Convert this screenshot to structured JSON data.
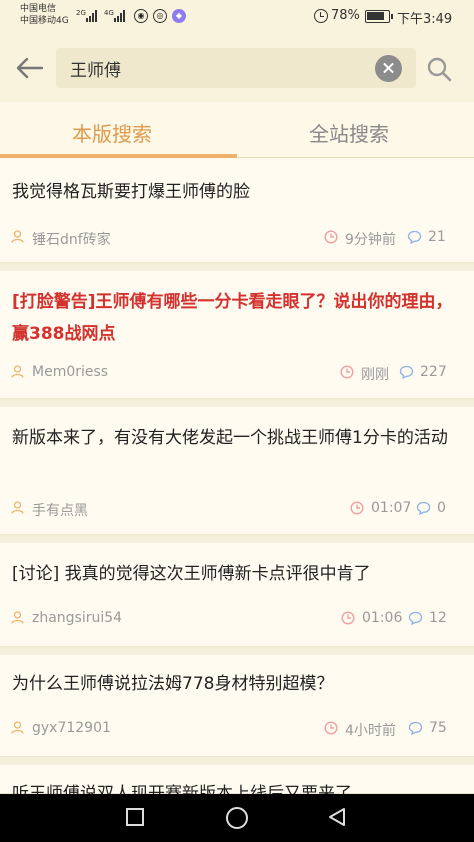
{
  "status_bar": {
    "carrier_1": "中国电信",
    "carrier_2": "中国移动4G",
    "sig_1": "2G",
    "sig_2": "4G",
    "battery": "78%",
    "time": "下午3:49"
  },
  "search": {
    "query": "王师傅"
  },
  "tabs": [
    {
      "label": "本版搜索",
      "active": true
    },
    {
      "label": "全站搜索",
      "active": false
    }
  ],
  "posts": [
    {
      "title": "我觉得格瓦斯要打爆王师傅的脸",
      "author": "锤石dnf砖家",
      "time": "9分钟前",
      "comments": "21",
      "highlight": false
    },
    {
      "title": "[打脸警告]王师傅有哪些一分卡看走眼了？说出你的理由，赢388战网点",
      "author": "Mem0riess",
      "time": "刚刚",
      "comments": "227",
      "highlight": true
    },
    {
      "title": "新版本来了，有没有大佬发起一个挑战王师傅1分卡的活动",
      "author": "手有点黑",
      "time": "01:07",
      "comments": "0",
      "highlight": false
    },
    {
      "title": "[讨论] 我真的觉得这次王师傅新卡点评很中肯了",
      "author": "zhangsirui54",
      "time": "01:06",
      "comments": "12",
      "highlight": false
    },
    {
      "title": "为什么王师傅说拉法姆778身材特别超模？",
      "author": "gyx712901",
      "time": "4小时前",
      "comments": "75",
      "highlight": false
    },
    {
      "title": "听王师傅说双人现开赛新版本上线后又要来了",
      "author": "",
      "time": "",
      "comments": "",
      "highlight": false
    }
  ],
  "colors": {
    "accent": "#e09a4c",
    "highlight_title": "#d3322f",
    "background": "#fdf8e8"
  },
  "icons": {
    "back": "arrow-left-icon",
    "clear": "clear-icon",
    "search": "search-icon",
    "user": "user-icon",
    "time": "clock-icon",
    "comment": "comment-icon"
  }
}
